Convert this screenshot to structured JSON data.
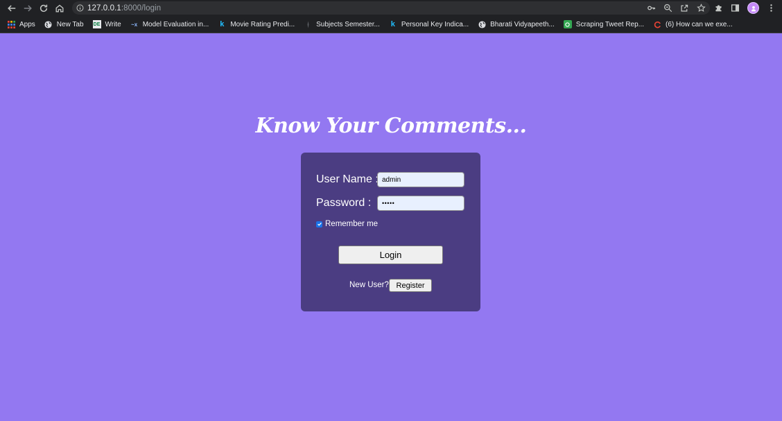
{
  "browser": {
    "url_host": "127.0.0.1",
    "url_path": ":8000/login",
    "bookmarks": [
      {
        "label": "Apps",
        "icon": "apps-grid-icon"
      },
      {
        "label": "New Tab",
        "icon": "globe-icon"
      },
      {
        "label": "Write",
        "icon": "write-icon"
      },
      {
        "label": "Model Evaluation in...",
        "icon": "model-icon"
      },
      {
        "label": "Movie Rating Predi...",
        "icon": "kaggle-icon"
      },
      {
        "label": "Subjects Semester...",
        "icon": "subjects-icon"
      },
      {
        "label": "Personal Key Indica...",
        "icon": "kaggle-icon"
      },
      {
        "label": "Bharati Vidyapeeth...",
        "icon": "globe-icon"
      },
      {
        "label": "Scraping Tweet Rep...",
        "icon": "scraping-icon"
      },
      {
        "label": "(6) How can we exe...",
        "icon": "quora-icon"
      }
    ]
  },
  "page": {
    "title": "Know Your Comments...",
    "username_label": "User Name :",
    "username_value": "admin",
    "password_label": "Password :",
    "password_value": "•••••",
    "remember_label": "Remember me",
    "remember_checked": true,
    "login_label": "Login",
    "new_user_label": "New User?",
    "register_label": "Register"
  },
  "colors": {
    "page_bg": "#9378f1",
    "card_bg": "#4b3d82",
    "chrome_bg": "#202124",
    "field_bg": "#e8f0fe",
    "checkbox": "#1a73e8"
  }
}
